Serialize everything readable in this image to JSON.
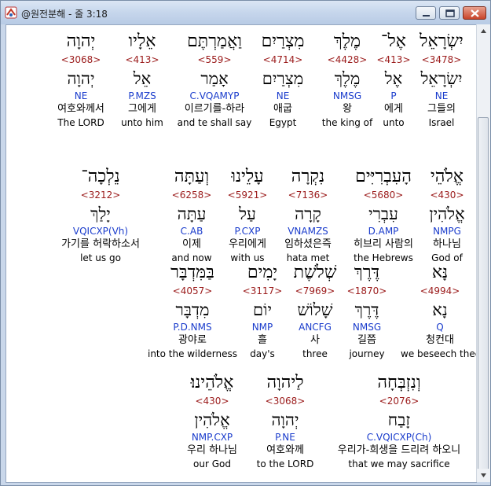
{
  "window": {
    "title": "@원전분해 - 줄 3:18",
    "icon": "app-logo-icon",
    "controls": [
      "minimize-icon",
      "maximize-icon",
      "close-icon"
    ]
  },
  "rows": [
    {
      "words": [
        {
          "heb": "יְהוָה",
          "num": "<3068>",
          "lemma": "יְהוָה",
          "parse": "NE",
          "kor": "여호와께서",
          "eng": "The LORD"
        },
        {
          "heb": "אֵלָיו",
          "num": "<413>",
          "lemma": "אֵל",
          "parse": "P.MZS",
          "kor": "그에게",
          "eng": "unto him"
        },
        {
          "heb": "וַאֲמַרְתֶּם",
          "num": "<559>",
          "lemma": "אָמַר",
          "parse": "C.VQAMYP",
          "kor": "이르기를-하라",
          "eng": "and te shall say"
        },
        {
          "heb": "מִצְרַיִם",
          "num": "<4714>",
          "lemma": "מִצְרַיִם",
          "parse": "NE",
          "kor": "애굽",
          "eng": "Egypt"
        },
        {
          "heb": "מֶלֶךְ",
          "num": "<4428>",
          "lemma": "מֶלֶךְ",
          "parse": "NMSG",
          "kor": "왕",
          "eng": "the king of"
        },
        {
          "heb": "אֶל־",
          "num": "<413>",
          "lemma": "אֶל",
          "parse": "P",
          "kor": "에게",
          "eng": "unto"
        },
        {
          "heb": "יִשְׂרָאֵל",
          "num": "<3478>",
          "lemma": "יִשְׂרָאֵל",
          "parse": "NE",
          "kor": "그들의",
          "eng": "Israel"
        }
      ]
    },
    {
      "words": [
        {
          "heb": "נֵלְכָה־",
          "num": "<3212>",
          "lemma": "יָלַךְ",
          "parse": "VQICXP(Vh)",
          "kor": "가기를 허락하소서",
          "eng": "let us go"
        },
        {
          "heb": "וְעַתָּה",
          "num": "<6258>",
          "lemma": "עַתָּה",
          "parse": "C.AB",
          "kor": "이제",
          "eng": "and now"
        },
        {
          "heb": "עָלֵינוּ",
          "num": "<5921>",
          "lemma": "עַל",
          "parse": "P.CXP",
          "kor": "우리에게",
          "eng": "with us"
        },
        {
          "heb": "נִקְרָה",
          "num": "<7136>",
          "lemma": "קָרָה",
          "parse": "VNAMZS",
          "kor": "임하셨은즉",
          "eng": "hata met"
        },
        {
          "heb": "הָעִבְרִיִּים",
          "num": "<5680>",
          "lemma": "עִבְרִי",
          "parse": "D.AMP",
          "kor": "히브리 사람의",
          "eng": "the Hebrews"
        },
        {
          "heb": "אֱלֹהֵי",
          "num": "<430>",
          "lemma": "אֱלֹהִין",
          "parse": "NMPG",
          "kor": "하나님",
          "eng": "God of"
        }
      ]
    },
    {
      "words": [
        {
          "heb": "בַּמִּדְבָּר",
          "num": "<4057>",
          "lemma": "מִדְבָּר",
          "parse": "P.D.NMS",
          "kor": "광야로",
          "eng": "into the wilderness"
        },
        {
          "heb": "יָמִים",
          "num": "<3117>",
          "lemma": "יוֹם",
          "parse": "NMP",
          "kor": "흘",
          "eng": "day's"
        },
        {
          "heb": "שְׁלֹשֶׁת",
          "num": "<7969>",
          "lemma": "שָׁלוֹשׁ",
          "parse": "ANCFG",
          "kor": "사",
          "eng": "three"
        },
        {
          "heb": "דֶּרֶךְ",
          "num": "<1870>",
          "lemma": "דֶּרֶךְ",
          "parse": "NMSG",
          "kor": "길쯤",
          "eng": "journey"
        },
        {
          "heb": "נָּא",
          "num": "<4994>",
          "lemma": "נָא",
          "parse": "Q",
          "kor": "청컨대",
          "eng": "we beseech thee"
        }
      ]
    },
    {
      "words": [
        {
          "heb": "אֱלֹהֵינוּ׃",
          "num": "<430>",
          "lemma": "אֱלֹהִין",
          "parse": "NMP.CXP",
          "kor": "우리 하나님",
          "eng": "our God"
        },
        {
          "heb": "לַיהוָה",
          "num": "<3068>",
          "lemma": "יְהוָה",
          "parse": "P.NE",
          "kor": "여호와께",
          "eng": "to the LORD"
        },
        {
          "heb": "וְנִזְבְּחָה",
          "num": "<2076>",
          "lemma": "זָבַח",
          "parse": "C.VQICXP(Ch)",
          "kor": "우리가-희생을 드리려 하오니",
          "eng": "that we may sacrifice"
        }
      ]
    }
  ]
}
